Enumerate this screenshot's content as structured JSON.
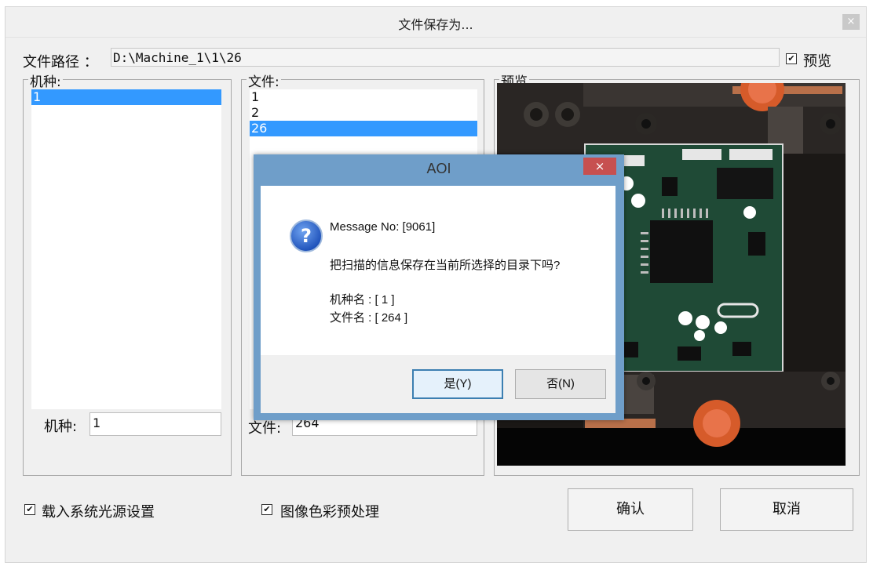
{
  "window": {
    "title": "文件保存为...",
    "close_glyph": "×"
  },
  "path": {
    "label": "文件路径 ：",
    "value": "D:\\Machine_1\\1\\26",
    "preview_checked": true,
    "preview_label": "预览"
  },
  "machine_group": {
    "title": "机种:",
    "items": [
      "1"
    ],
    "selected_index": 0,
    "field_label": "机种:",
    "field_value": "1"
  },
  "file_group": {
    "title": "文件:",
    "items": [
      "1",
      "2",
      "26"
    ],
    "selected_index": 2,
    "field_label": "文件:",
    "field_value": "264"
  },
  "preview_group": {
    "title": "预览"
  },
  "options": {
    "load_light": {
      "checked": true,
      "label": "载入系统光源设置"
    },
    "image_color": {
      "checked": true,
      "label": "图像色彩预处理"
    }
  },
  "buttons": {
    "confirm": "确认",
    "cancel": "取消"
  },
  "dialog": {
    "title": "AOI",
    "close_glyph": "×",
    "icon": "question-icon",
    "message_no": "Message No: [9061]",
    "question": "把扫描的信息保存在当前所选择的目录下吗?",
    "machine_line": "机种名 : [ 1 ]",
    "file_line": "文件名 : [ 264 ]",
    "yes_label": "是(Y)",
    "no_label": "否(N)"
  },
  "colors": {
    "selection": "#3399ff",
    "dialog_frame": "#6f9ec9",
    "dialog_close": "#c75050",
    "pcb_green": "#1f4a36"
  }
}
